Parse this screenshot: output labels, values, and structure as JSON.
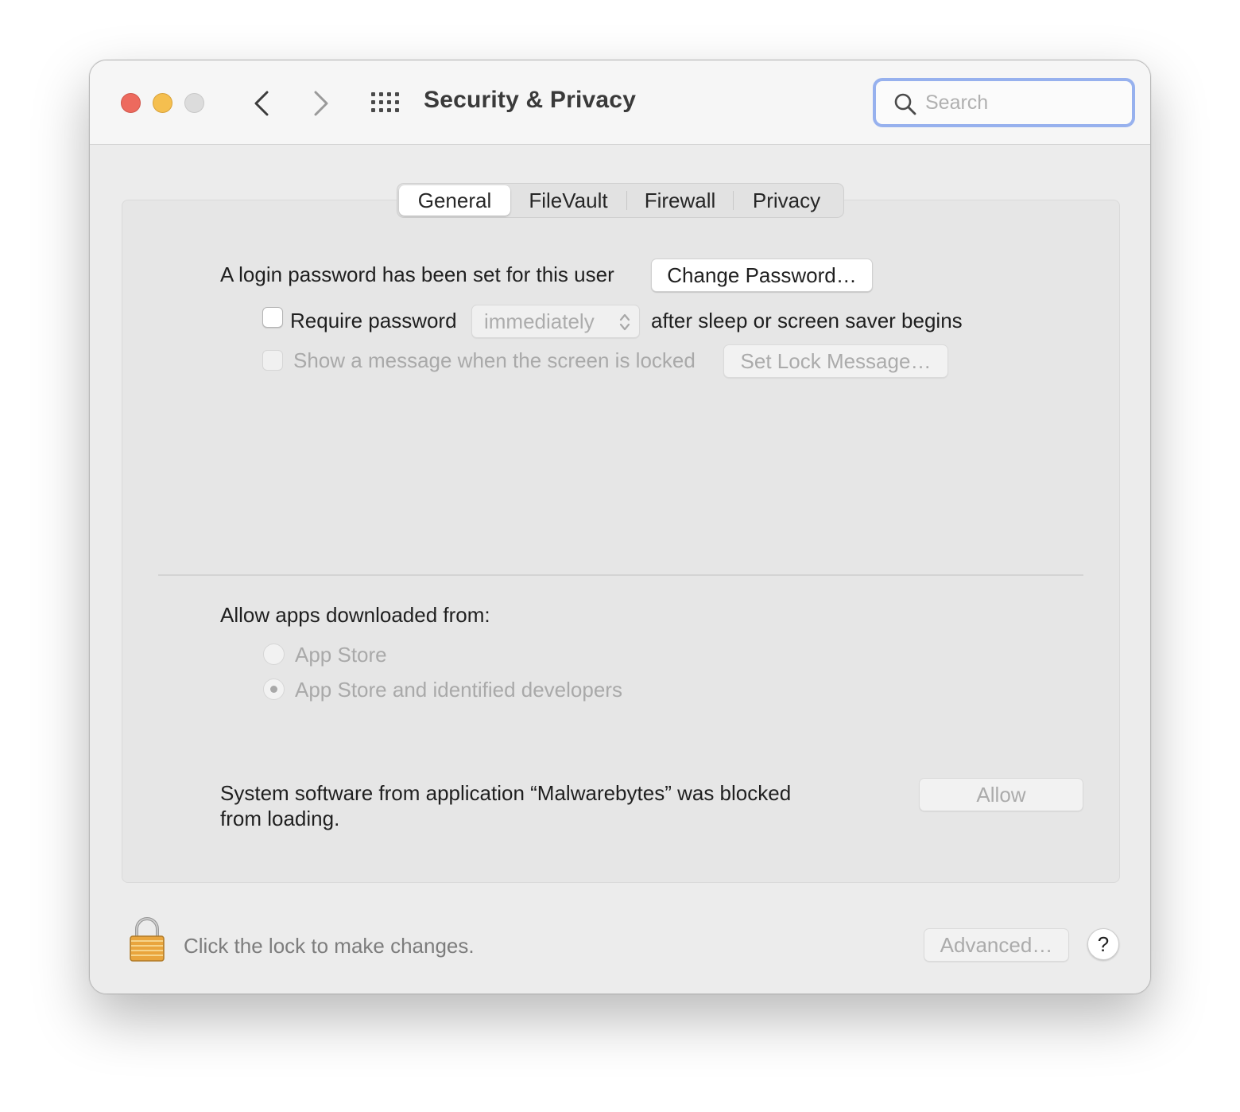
{
  "window": {
    "title": "Security & Privacy",
    "search_placeholder": "Search"
  },
  "tabs": [
    {
      "label": "General",
      "active": true
    },
    {
      "label": "FileVault",
      "active": false
    },
    {
      "label": "Firewall",
      "active": false
    },
    {
      "label": "Privacy",
      "active": false
    }
  ],
  "general": {
    "login_password_text": "A login password has been set for this user",
    "change_password_label": "Change Password…",
    "require_password_label": "Require password",
    "require_password_checked": false,
    "require_password_delay": "immediately",
    "after_sleep_text": "after sleep or screen saver begins",
    "show_message_label": "Show a message when the screen is locked",
    "show_message_checked": false,
    "set_lock_message_label": "Set Lock Message…"
  },
  "allow_apps": {
    "heading": "Allow apps downloaded from:",
    "options": [
      {
        "label": "App Store",
        "selected": false
      },
      {
        "label": "App Store and identified developers",
        "selected": true
      }
    ]
  },
  "blocked": {
    "line1": "System software from application “Malwarebytes” was blocked",
    "line2": "from loading.",
    "allow_label": "Allow"
  },
  "footer": {
    "lock_text": "Click the lock to make changes.",
    "advanced_label": "Advanced…",
    "help_label": "?"
  },
  "colors": {
    "close": "#ed6a5e",
    "minimize": "#f5bf4f",
    "search_focus": "#97b1ee"
  },
  "icons": [
    "chevron-left-icon",
    "chevron-right-icon",
    "grid-icon",
    "search-icon",
    "popup-arrows-icon",
    "lock-icon"
  ]
}
